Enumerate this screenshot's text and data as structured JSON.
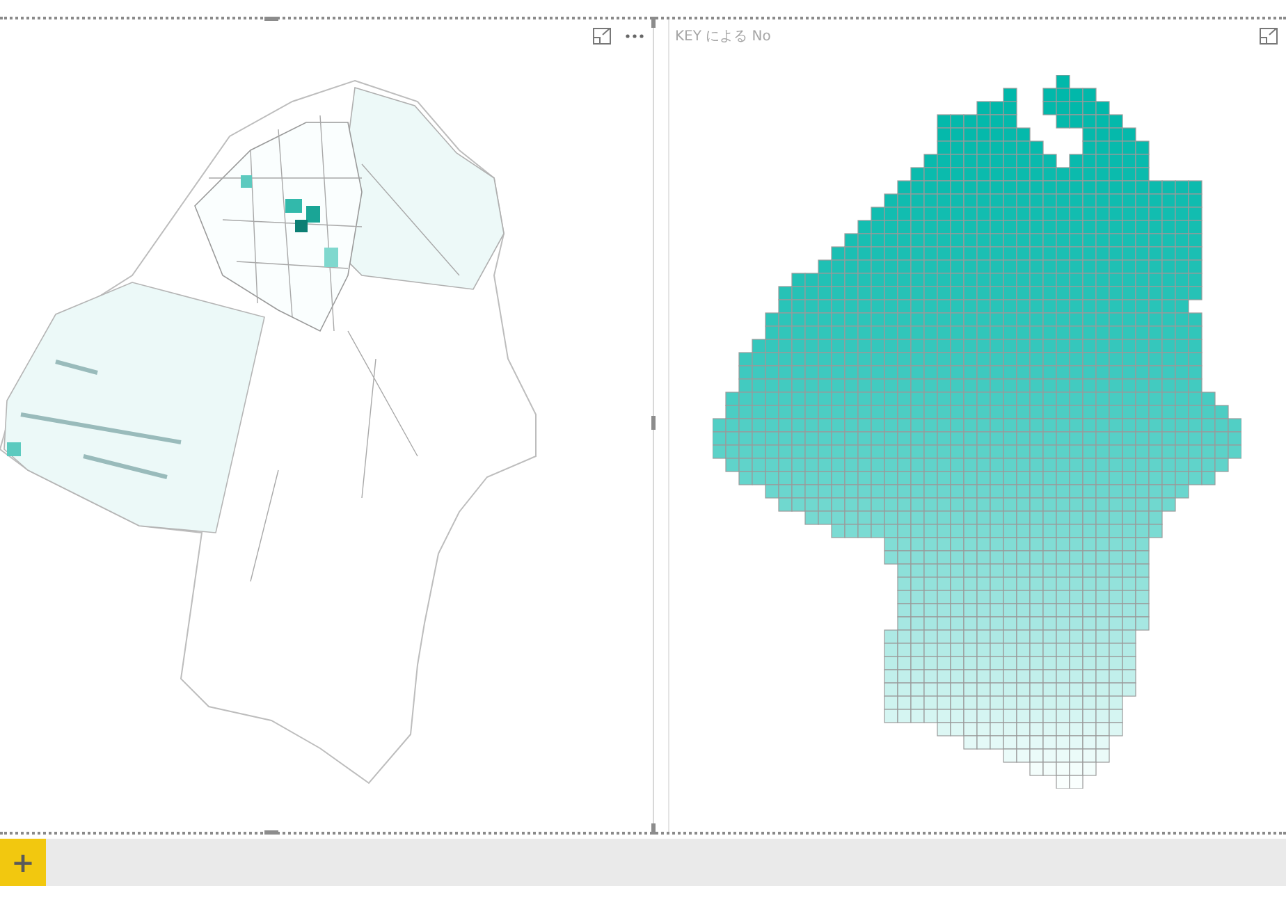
{
  "visuals": [
    {
      "kind": "filled-map",
      "hovered": true
    },
    {
      "kind": "grid-map",
      "hovered": false,
      "title": "KEY による No"
    }
  ],
  "page_tabs": {
    "add_button": "+"
  }
}
